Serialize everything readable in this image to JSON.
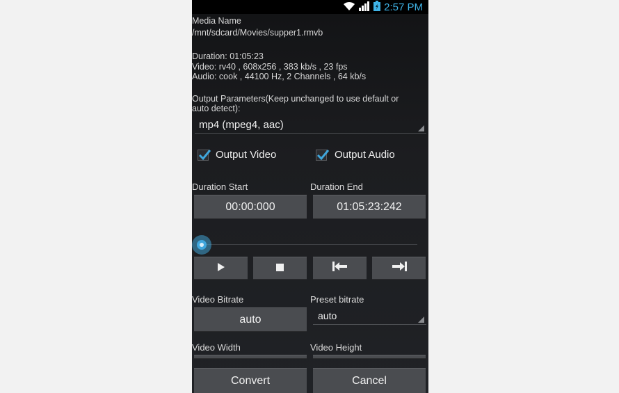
{
  "status_bar": {
    "time": "2:57 PM",
    "icons": [
      "wifi-icon",
      "signal-icon",
      "battery-icon"
    ]
  },
  "media": {
    "name_label": "Media Name",
    "path": "/mnt/sdcard/Movies/supper1.rmvb",
    "duration": "Duration: 01:05:23",
    "video_info": "Video: rv40 , 608x256 , 383 kb/s , 23 fps",
    "audio_info": "Audio: cook , 44100 Hz, 2 Channels , 64 kb/s"
  },
  "output": {
    "params_label_line1": "Output Parameters(Keep unchanged to use default or",
    "params_label_line2": "auto detect):",
    "format_selected": "mp4 (mpeg4, aac)",
    "output_video_label": "Output Video",
    "output_video_checked": true,
    "output_audio_label": "Output Audio",
    "output_audio_checked": true
  },
  "duration_range": {
    "start_label": "Duration Start",
    "start_value": "00:00:000",
    "end_label": "Duration End",
    "end_value": "01:05:23:242",
    "slider_position": 0
  },
  "playback": {
    "buttons": [
      "play-icon",
      "stop-icon",
      "set-start-icon",
      "set-end-icon"
    ]
  },
  "bitrate": {
    "video_bitrate_label": "Video Bitrate",
    "video_bitrate_value": "auto",
    "preset_label": "Preset bitrate",
    "preset_value": "auto"
  },
  "dimensions": {
    "width_label": "Video Width",
    "height_label": "Video Height"
  },
  "actions": {
    "convert_label": "Convert",
    "cancel_label": "Cancel"
  },
  "colors": {
    "accent": "#3fa6dc",
    "background": "#1c1d20",
    "button": "#4a4c50"
  }
}
